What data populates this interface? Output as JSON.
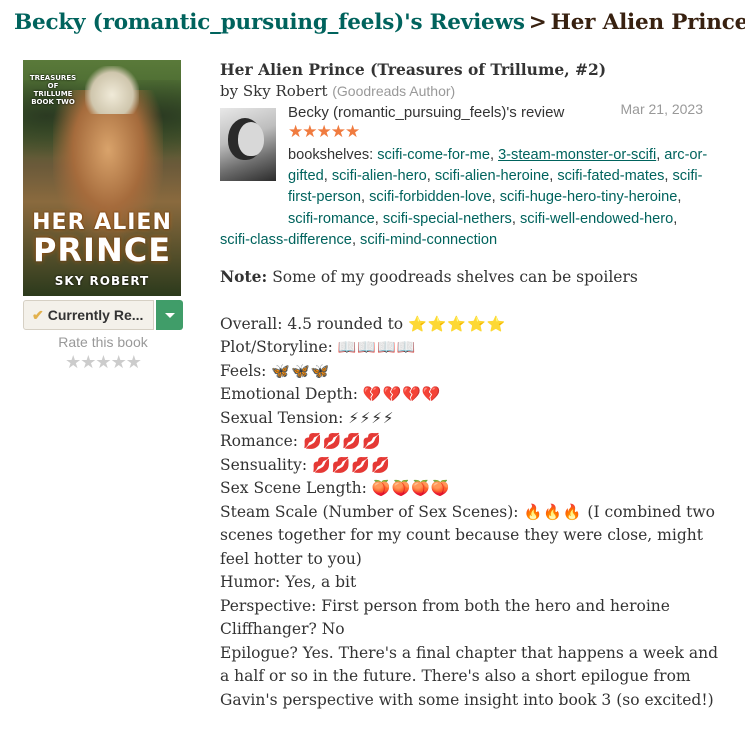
{
  "header": {
    "reviewer_link": "Becky (romantic_pursuing_feels)'s Reviews",
    "separator": ">",
    "book_name": "Her Alien Prince"
  },
  "cover": {
    "series_text": "TREASURES OF TRILLUME BOOK TWO",
    "title_line1": "HER ALIEN",
    "title_line2": "PRINCE",
    "author": "SKY ROBERT"
  },
  "shelf": {
    "status_label": "Currently Re...",
    "check_icon": "checkmark-icon",
    "dropdown_icon": "triangle-down-icon"
  },
  "rating": {
    "prompt": "Rate this book",
    "empty_stars": "★★★★★",
    "user_rating": 5
  },
  "book": {
    "title": "Her Alien Prince (Treasures of Trillume, #2)",
    "by_label": "by",
    "author": "Sky Robert",
    "author_role": "(Goodreads Author)"
  },
  "review": {
    "reviewer": "Becky (romantic_pursuing_feels)'s review",
    "date": "Mar 21, 2023",
    "stars": "★★★★★",
    "shelves_label": "bookshelves:",
    "shelves": [
      "scifi-come-for-me",
      "3-steam-monster-or-scifi",
      "arc-or-gifted",
      "scifi-alien-hero",
      "scifi-alien-heroine",
      "scifi-fated-mates",
      "scifi-first-person",
      "scifi-forbidden-love",
      "scifi-huge-hero-tiny-heroine",
      "scifi-romance",
      "scifi-special-nethers",
      "scifi-well-endowed-hero",
      "scifi-class-difference",
      "scifi-mind-connection"
    ],
    "note_label": "Note:",
    "note_text": "Some of my goodreads shelves can be spoilers",
    "lines": [
      {
        "label": "Overall: 4.5 rounded to",
        "icons": "⭐⭐⭐⭐⭐"
      },
      {
        "label": "Plot/Storyline:",
        "icons": "📖📖📖📖"
      },
      {
        "label": "Feels:",
        "icons": "🦋🦋🦋"
      },
      {
        "label": "Emotional Depth:",
        "icons": "💔💔💔💔"
      },
      {
        "label": "Sexual Tension:",
        "icons": "⚡⚡⚡⚡"
      },
      {
        "label": "Romance:",
        "icons": "💋💋💋💋"
      },
      {
        "label": "Sensuality:",
        "icons": "💋💋💋💋"
      },
      {
        "label": "Sex Scene Length:",
        "icons": "🍑🍑🍑🍑"
      },
      {
        "label": "Steam Scale (Number of Sex Scenes):",
        "icons": "🔥🔥🔥"
      }
    ],
    "steam_note": "(I combined two scenes together for my count because they were close, might feel hotter to you)",
    "humor": "Humor: Yes, a bit",
    "perspective": "Perspective: First person from both the hero and heroine",
    "cliffhanger": "Cliffhanger? No",
    "epilogue": "Epilogue? Yes. There's a final chapter that happens a week and a half or so in the future. There's also a short epilogue from Gavin's perspective with some insight into book 3 (so excited!)"
  },
  "colors": {
    "link_green": "#00635d",
    "heading_brown": "#382110",
    "star_orange": "#f07b3f",
    "dropdown_green": "#409d69",
    "muted_gray": "#999999"
  }
}
